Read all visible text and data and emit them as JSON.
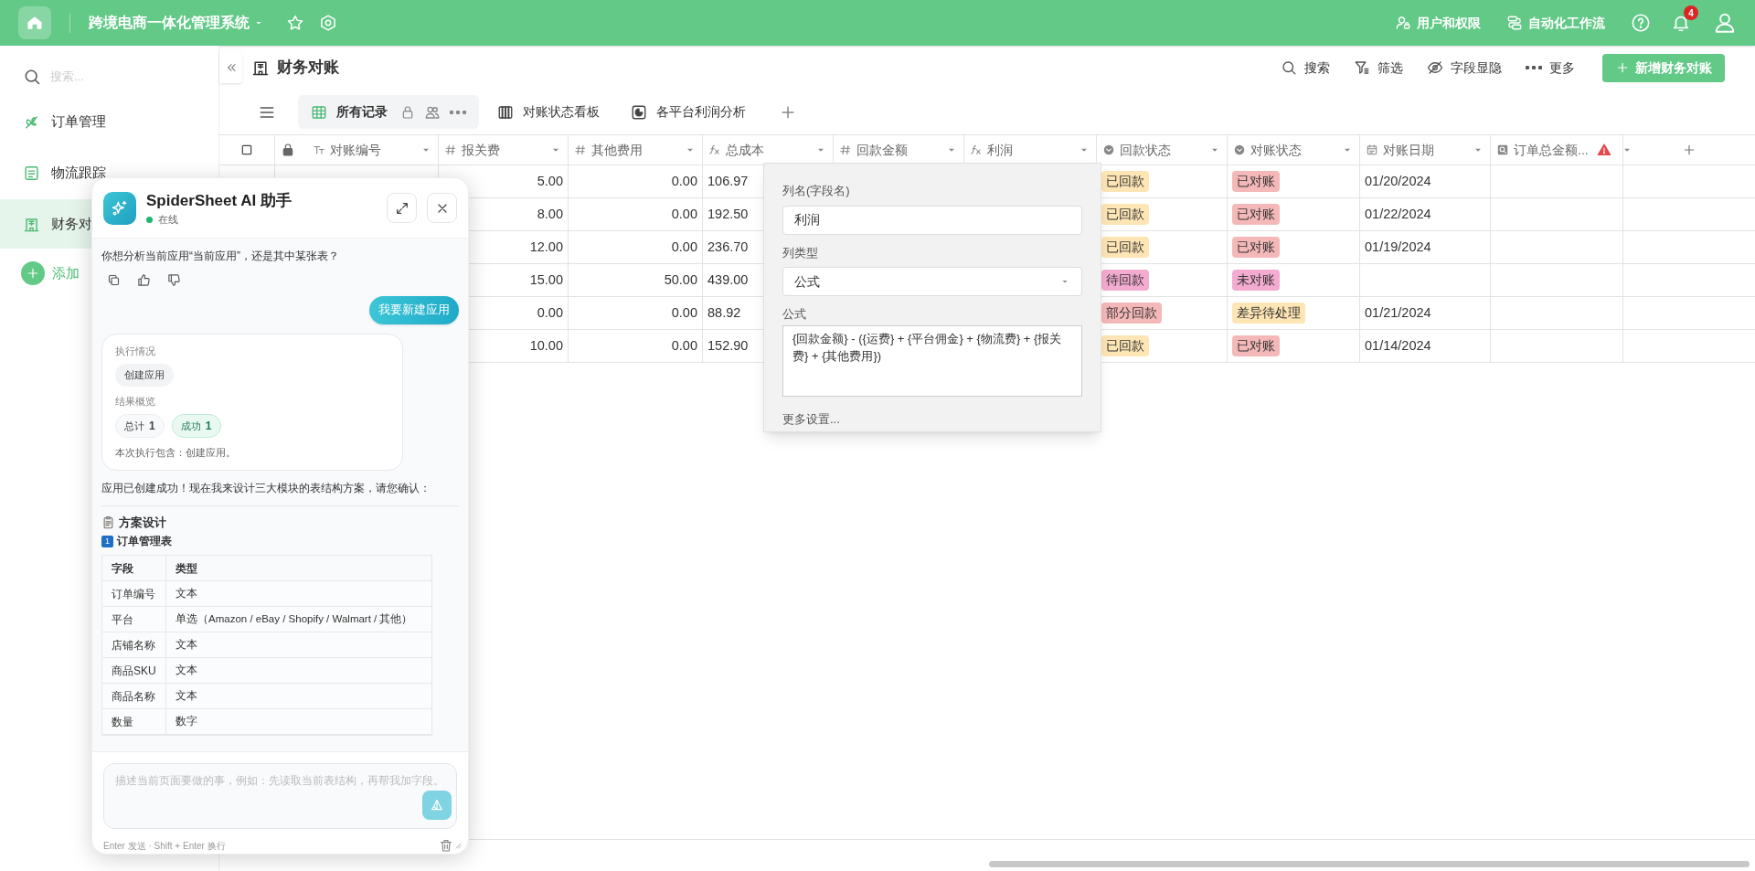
{
  "app_bar": {
    "title": "跨境电商一体化管理系统",
    "links": [
      "用户和权限",
      "自动化工作流"
    ],
    "notification_count": "4"
  },
  "sidebar": {
    "search_placeholder": "搜索...",
    "items": [
      {
        "label": "订单管理",
        "selected": false
      },
      {
        "label": "物流跟踪",
        "selected": false
      },
      {
        "label": "财务对",
        "selected": true
      }
    ],
    "add_label": "添加"
  },
  "page": {
    "title": "财务对账",
    "actions": [
      "搜索",
      "筛选",
      "字段显隐",
      "更多"
    ],
    "primary_button": "新增财务对账"
  },
  "views": [
    {
      "label": "所有记录",
      "kind": "grid",
      "selected": true
    },
    {
      "label": "对账状态看板",
      "kind": "kanban",
      "selected": false
    },
    {
      "label": "各平台利润分析",
      "kind": "chart",
      "selected": false
    }
  ],
  "table": {
    "columns": [
      {
        "label": "对账编号",
        "kind": "text",
        "warning": false
      },
      {
        "label": "报关费",
        "kind": "number",
        "warning": false
      },
      {
        "label": "其他费用",
        "kind": "number",
        "warning": false
      },
      {
        "label": "总成本",
        "kind": "formula",
        "warning": false
      },
      {
        "label": "回款金额",
        "kind": "number",
        "warning": false
      },
      {
        "label": "利润",
        "kind": "formula",
        "warning": false
      },
      {
        "label": "回款状态",
        "kind": "select",
        "warning": false
      },
      {
        "label": "对账状态",
        "kind": "select",
        "warning": false
      },
      {
        "label": "对账日期",
        "kind": "date",
        "warning": false
      },
      {
        "label": "订单总金额...",
        "kind": "lookup",
        "warning": true
      }
    ],
    "rows": [
      {
        "customs_fee": "5.00",
        "other_fees": "0.00",
        "total_cost": "106.97",
        "payment_status": {
          "text": "已回款",
          "color": "#fde5b4"
        },
        "reconcile_status": {
          "text": "已对账",
          "color": "#f5b8b8"
        },
        "date": "01/20/2024"
      },
      {
        "customs_fee": "8.00",
        "other_fees": "0.00",
        "total_cost": "192.50",
        "payment_status": {
          "text": "已回款",
          "color": "#fde5b4"
        },
        "reconcile_status": {
          "text": "已对账",
          "color": "#f5b8b8"
        },
        "date": "01/22/2024"
      },
      {
        "customs_fee": "12.00",
        "other_fees": "0.00",
        "total_cost": "236.70",
        "payment_status": {
          "text": "已回款",
          "color": "#fde5b4"
        },
        "reconcile_status": {
          "text": "已对账",
          "color": "#f5b8b8"
        },
        "date": "01/19/2024"
      },
      {
        "customs_fee": "15.00",
        "other_fees": "50.00",
        "total_cost": "439.00",
        "payment_status": {
          "text": "待回款",
          "color": "#f4abd0"
        },
        "reconcile_status": {
          "text": "未对账",
          "color": "#f4abd0"
        }
      },
      {
        "customs_fee": "0.00",
        "other_fees": "0.00",
        "total_cost": "88.92",
        "payment_status": {
          "text": "部分回款",
          "color": "#f5b8b8"
        },
        "reconcile_status": {
          "text": "差异待处理",
          "color": "#fde5b4"
        },
        "date": "01/21/2024"
      },
      {
        "customs_fee": "10.00",
        "other_fees": "0.00",
        "total_cost": "152.90",
        "payment_status": {
          "text": "已回款",
          "color": "#fde5b4"
        },
        "reconcile_status": {
          "text": "已对账",
          "color": "#f5b8b8"
        },
        "date": "01/14/2024"
      }
    ]
  },
  "field_editor": {
    "name_label": "列名(字段名)",
    "name_value": "利润",
    "type_label": "列类型",
    "type_value": "公式",
    "formula_label": "公式",
    "formula_value": "{回款金额} - ({运费} + {平台佣金} + {物流费} + {报关费} + {其他费用})",
    "more_link": "更多设置..."
  },
  "assistant": {
    "title": "SpiderSheet AI 助手",
    "status": "在线",
    "messages": [
      {
        "kind": "text",
        "text": "你想分析当前应用“当前应用”，还是其中某张表？",
        "feedback_actions": true
      },
      {
        "kind": "user",
        "text": "我要新建应用"
      },
      {
        "kind": "result",
        "status_label": "执行情况",
        "steps": [
          "创建应用"
        ],
        "summary_label": "结果概览",
        "stats": [
          {
            "label": "总计",
            "value": "1",
            "kind": "total"
          },
          {
            "label": "成功",
            "value": "1",
            "kind": "success"
          }
        ],
        "note": "本次执行包含：创建应用。"
      },
      {
        "kind": "text",
        "text": "应用已创建成功！现在我来设计三大模块的表结构方案，请您确认：",
        "feedback_actions": false
      },
      {
        "kind": "plan",
        "heading": "方案设计",
        "sub_number": "1",
        "subheading": "订单管理表",
        "columns": [
          "字段",
          "类型"
        ],
        "rows": [
          [
            "订单编号",
            "文本"
          ],
          [
            "平台",
            "单选（Amazon / eBay / Shopify / Walmart / 其他）"
          ],
          [
            "店铺名称",
            "文本"
          ],
          [
            "商品SKU",
            "文本"
          ],
          [
            "商品名称",
            "文本"
          ],
          [
            "数量",
            "数字"
          ]
        ]
      }
    ],
    "input_placeholder": "描述当前页面要做的事，例如：先读取当前表结构，再帮我加字段。",
    "hint": "Enter 发送 · Shift + Enter 换行"
  }
}
